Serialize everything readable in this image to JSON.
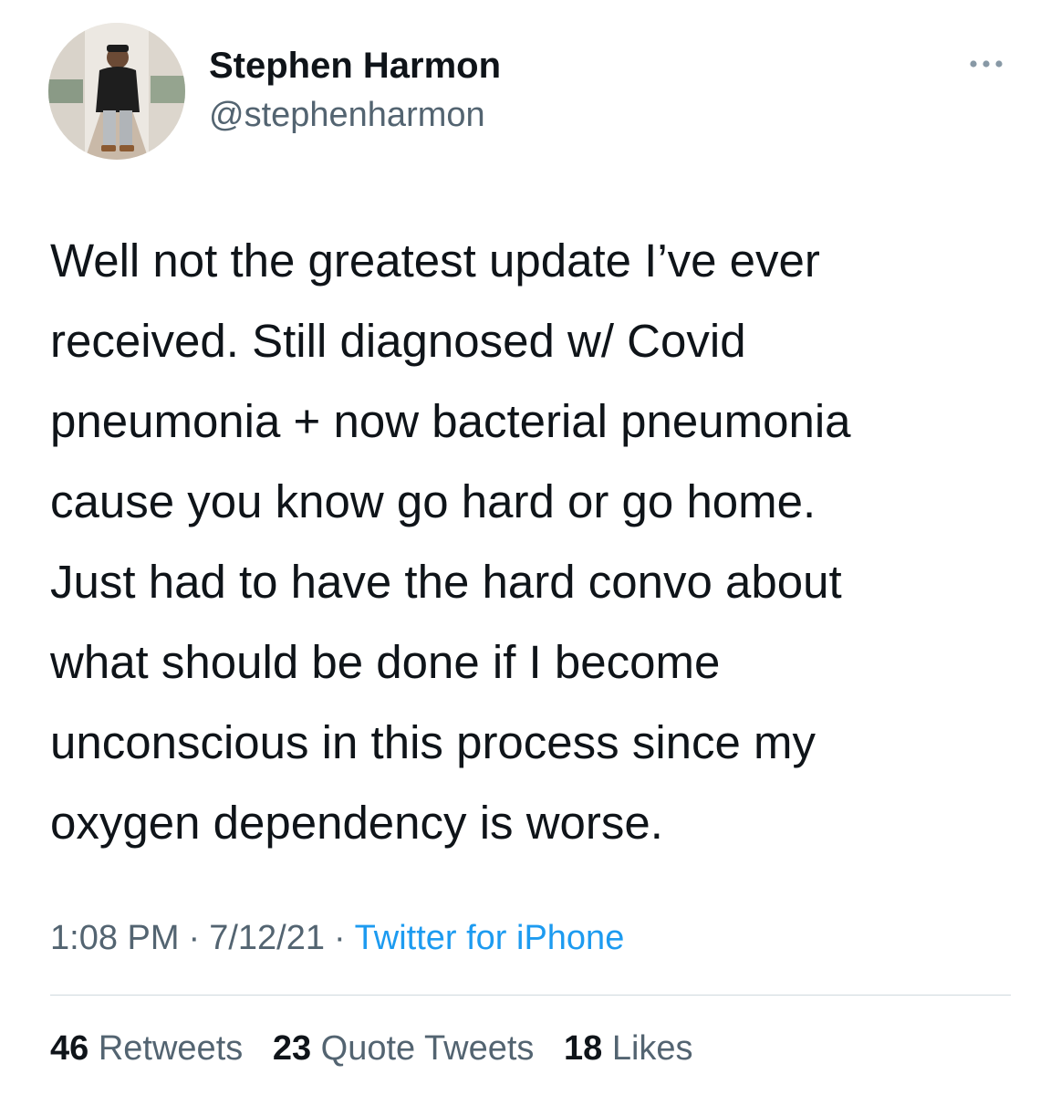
{
  "tweet": {
    "author": {
      "display_name": "Stephen Harmon",
      "handle": "@stephenharmon",
      "avatar_icon": "profile-photo"
    },
    "more_icon": "more-horizontal-icon",
    "text": "Well not the greatest update I’ve ever\nreceived. Still diagnosed w/ Covid\npneumonia + now bacterial pneumonia\ncause you know go hard or go home.\nJust had to have the hard convo about\nwhat should be done if I become\nunconscious in this process since my\noxygen dependency is worse.",
    "time": "1:08 PM",
    "date": "7/12/21",
    "separator": "·",
    "source": "Twitter for iPhone",
    "stats": {
      "retweets": {
        "count": "46",
        "label": "Retweets"
      },
      "quote_tweets": {
        "count": "23",
        "label": "Quote Tweets"
      },
      "likes": {
        "count": "18",
        "label": "Likes"
      }
    }
  },
  "colors": {
    "text_primary": "#0f1419",
    "text_secondary": "#536471",
    "link": "#1d9bf0",
    "divider": "#cfd9de"
  }
}
